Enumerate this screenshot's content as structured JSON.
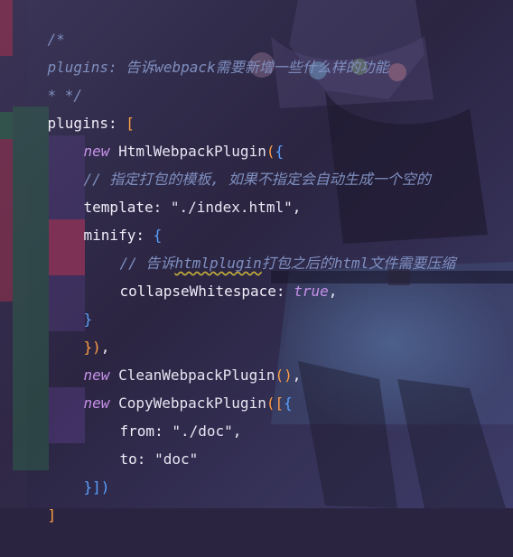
{
  "editor": {
    "colors": {
      "comment": "#7f8fbf",
      "keyword": "#c792ea",
      "punctuation": "#ff9f45",
      "brace": "#5aa0ff",
      "text": "#e8e4f2",
      "guide_red": "#a8324e",
      "guide_green": "#2f6a4a",
      "guide_purple": "#5a3f8a"
    },
    "lines": [
      {
        "comment": "/*"
      },
      {
        "comment": "plugins: 告诉webpack需要新增一些什么样的功能"
      },
      {
        "comment": "* */"
      },
      {
        "key": "plugins",
        "colon": ": ",
        "open": "["
      },
      {
        "kw": "new",
        "cls": " HtmlWebpackPlugin",
        "paren": "(",
        "open": "{"
      },
      {
        "comment": "// 指定打包的模板, 如果不指定会自动生成一个空的"
      },
      {
        "key": "template",
        "colon": ": ",
        "str": "\"./index.html\"",
        "comma": ","
      },
      {
        "key": "minify",
        "colon": ": ",
        "open": "{"
      },
      {
        "comment_pre": "// 告诉",
        "comment_link": "htmlplugin",
        "comment_post": "打包之后的html文件需要压缩"
      },
      {
        "key": "collapseWhitespace",
        "colon": ": ",
        "bool": "true",
        "comma": ","
      },
      {
        "close": "}"
      },
      {
        "close": "})",
        "comma": ","
      },
      {
        "kw": "new",
        "cls": " CleanWebpackPlugin",
        "paren": "()",
        "comma": ","
      },
      {
        "kw": "new",
        "cls": " CopyWebpackPlugin",
        "paren": "([",
        "open": "{"
      },
      {
        "key": "from",
        "colon": ": ",
        "str": "\"./doc\"",
        "comma": ","
      },
      {
        "key": "to",
        "colon": ": ",
        "str": "\"doc\""
      },
      {
        "close": "}])"
      },
      {
        "close": "]"
      }
    ]
  }
}
